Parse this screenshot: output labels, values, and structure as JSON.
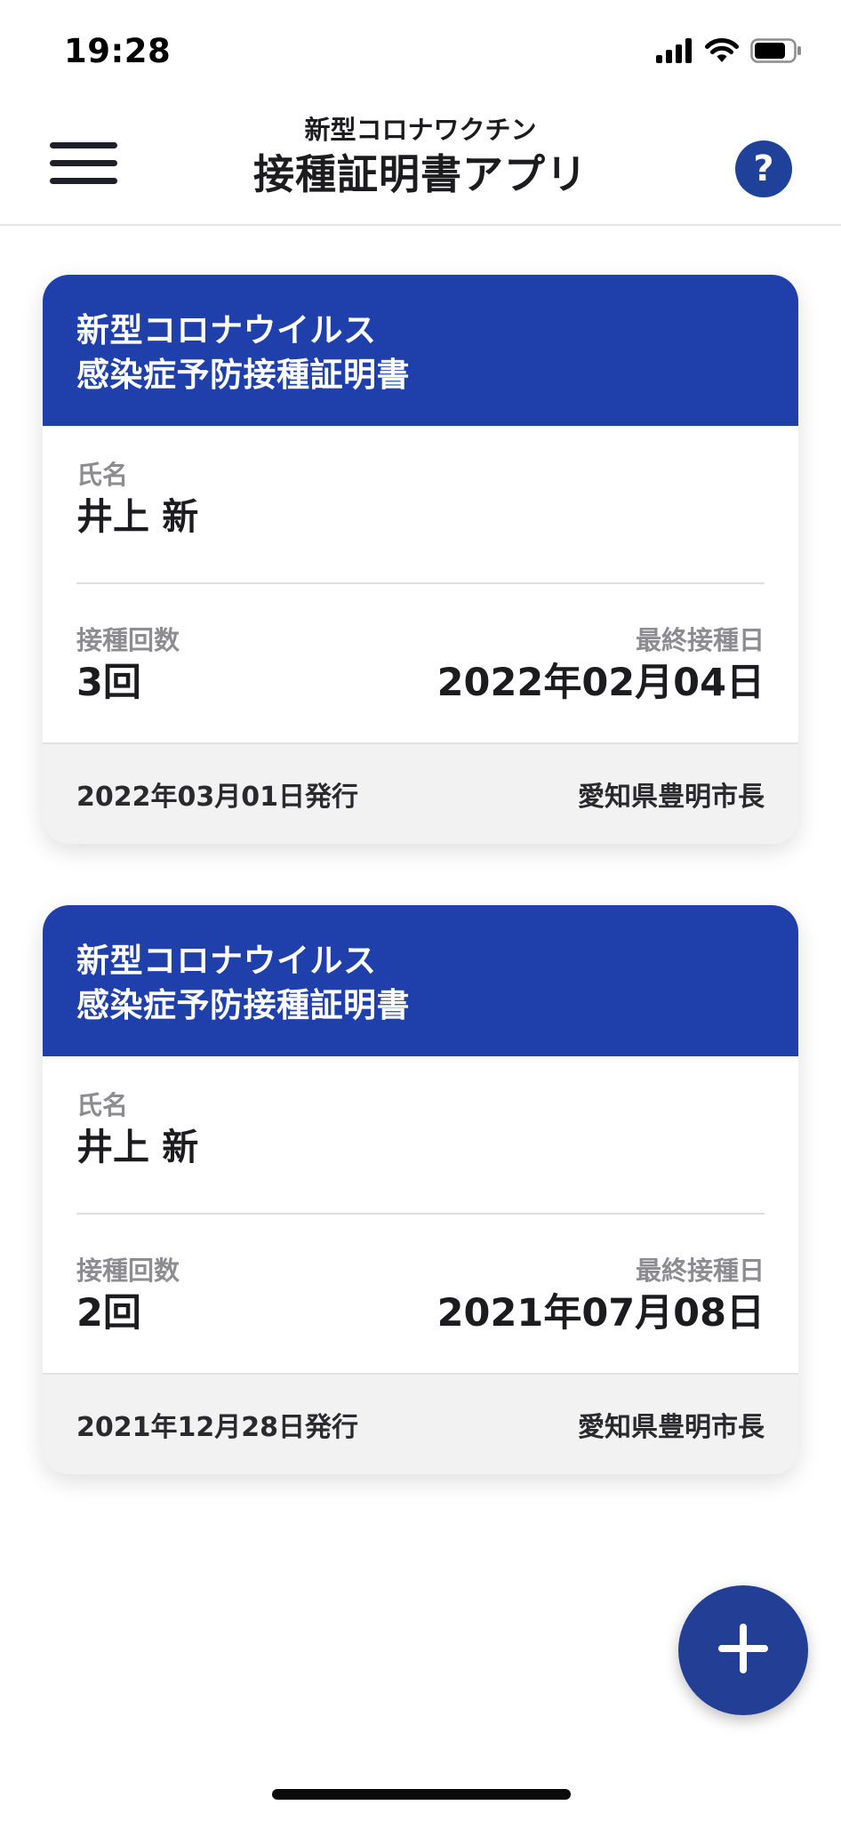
{
  "status_bar": {
    "time": "19:28",
    "icons": [
      "cellular-signal-icon",
      "wifi-icon",
      "battery-icon"
    ]
  },
  "header": {
    "subtitle": "新型コロナワクチン",
    "title": "接種証明書アプリ",
    "menu_icon": "hamburger-menu-icon",
    "help_icon": "help-icon",
    "help_glyph": "?"
  },
  "theme": {
    "primary": "#1f40ab",
    "fab": "#223f95",
    "footer_bg": "#f2f2f3",
    "label_gray": "#8c8c91"
  },
  "labels": {
    "name": "氏名",
    "dose_count": "接種回数",
    "last_dose_date": "最終接種日"
  },
  "certificates": [
    {
      "title_line1": "新型コロナウイルス",
      "title_line2": "感染症予防接種証明書",
      "name": "井上 新",
      "dose_count": "3回",
      "last_dose_date": "2022年02月04日",
      "issued": "2022年03月01日発行",
      "issuer": "愛知県豊明市長"
    },
    {
      "title_line1": "新型コロナウイルス",
      "title_line2": "感染症予防接種証明書",
      "name": "井上 新",
      "dose_count": "2回",
      "last_dose_date": "2021年07月08日",
      "issued": "2021年12月28日発行",
      "issuer": "愛知県豊明市長"
    }
  ],
  "fab": {
    "icon": "plus-icon"
  }
}
